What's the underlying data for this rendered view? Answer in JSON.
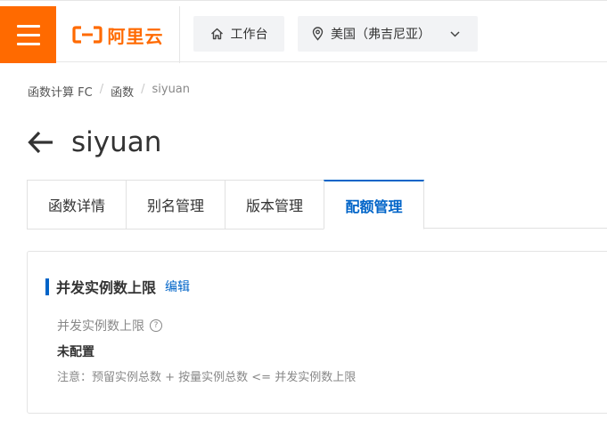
{
  "topbar": {
    "logo_text": "阿里云",
    "workbench_label": "工作台",
    "region_label": "美国（弗吉尼亚）",
    "brand_color": "#ff6a00"
  },
  "breadcrumb": {
    "items": [
      "函数计算 FC",
      "函数",
      "siyuan"
    ]
  },
  "page": {
    "title": "siyuan"
  },
  "tabs": [
    {
      "label": "函数详情",
      "active": false
    },
    {
      "label": "别名管理",
      "active": false
    },
    {
      "label": "版本管理",
      "active": false
    },
    {
      "label": "配额管理",
      "active": true
    }
  ],
  "card": {
    "title": "并发实例数上限",
    "edit_label": "编辑",
    "field_label": "并发实例数上限",
    "field_value": "未配置",
    "note": "注意：预留实例总数 + 按量实例总数 <= 并发实例数上限"
  },
  "icons": {
    "menu": "hamburger-icon",
    "logo": "aliyun-logo-icon",
    "workbench": "home-icon",
    "region": "location-pin-icon",
    "dropdown": "chevron-down-icon",
    "back": "arrow-left-icon",
    "help": "question-circle-icon"
  },
  "colors": {
    "accent": "#0064c8",
    "brand": "#ff6a00"
  }
}
